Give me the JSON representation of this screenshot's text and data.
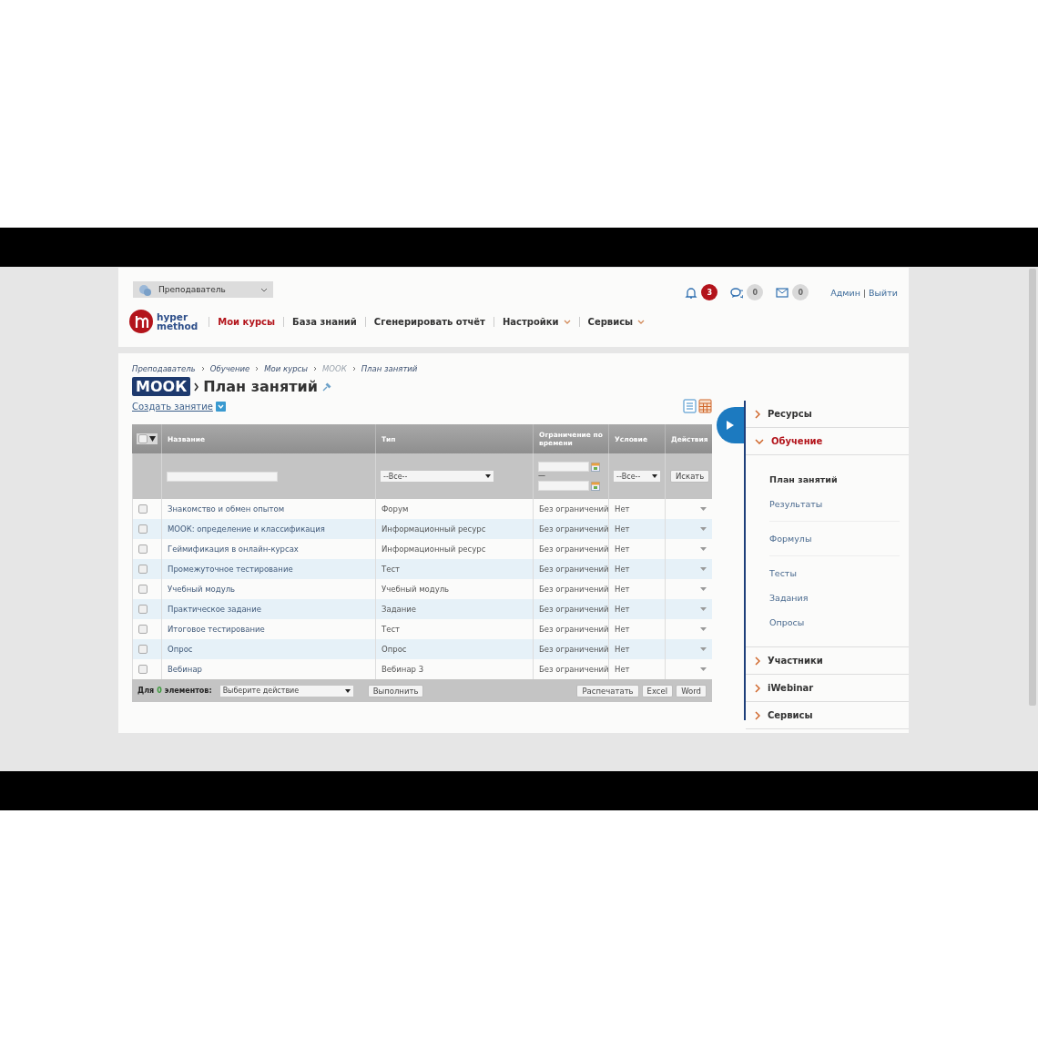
{
  "header": {
    "role_select": "Преподаватель",
    "logo": {
      "line1": "hyper",
      "line2": "method"
    },
    "nav": [
      {
        "label": "Мои курсы",
        "selected": true,
        "dropdown": false
      },
      {
        "label": "База знаний",
        "selected": false,
        "dropdown": false
      },
      {
        "label": "Сгенерировать отчёт",
        "selected": false,
        "dropdown": false
      },
      {
        "label": "Настройки",
        "selected": false,
        "dropdown": true
      },
      {
        "label": "Сервисы",
        "selected": false,
        "dropdown": true
      }
    ],
    "notifications": [
      {
        "kind": "bell",
        "count": "3",
        "highlighted": true
      },
      {
        "kind": "chat",
        "count": "0",
        "highlighted": false
      },
      {
        "kind": "mail",
        "count": "0",
        "highlighted": false
      }
    ],
    "user": "Админ",
    "user_separator": "|",
    "logout": "Выйти"
  },
  "breadcrumbs": [
    {
      "label": "Преподаватель",
      "disabled": false
    },
    {
      "label": "Обучение",
      "disabled": false
    },
    {
      "label": "Мои курсы",
      "disabled": false
    },
    {
      "label": "МООК",
      "disabled": true
    },
    {
      "label": "План занятий",
      "disabled": false
    }
  ],
  "title": {
    "course": "МООК",
    "page": "План занятий"
  },
  "create_link": "Создать занятие",
  "table": {
    "select_all": {
      "checked": false
    },
    "columns": [
      "Название",
      "Тип",
      "Ограничение по времени",
      "Условие",
      "Действия"
    ],
    "filters": {
      "type": "--Все--",
      "range_separator": "—",
      "condition": "--Все--",
      "search_button": "Искать"
    },
    "rows": [
      {
        "name": "Знакомство и обмен опытом",
        "type": "Форум",
        "time_limit": "Без ограничений",
        "condition": "Нет",
        "checked": false
      },
      {
        "name": "МООК: определение и классификация",
        "type": "Информационный ресурс",
        "time_limit": "Без ограничений",
        "condition": "Нет",
        "checked": false
      },
      {
        "name": "Геймификация в онлайн-курсах",
        "type": "Информационный ресурс",
        "time_limit": "Без ограничений",
        "condition": "Нет",
        "checked": false
      },
      {
        "name": "Промежуточное тестирование",
        "type": "Тест",
        "time_limit": "Без ограничений",
        "condition": "Нет",
        "checked": false
      },
      {
        "name": "Учебный модуль",
        "type": "Учебный модуль",
        "time_limit": "Без ограничений",
        "condition": "Нет",
        "checked": false
      },
      {
        "name": "Практическое задание",
        "type": "Задание",
        "time_limit": "Без ограничений",
        "condition": "Нет",
        "checked": false
      },
      {
        "name": "Итоговое тестирование",
        "type": "Тест",
        "time_limit": "Без ограничений",
        "condition": "Нет",
        "checked": false
      },
      {
        "name": "Опрос",
        "type": "Опрос",
        "time_limit": "Без ограничений",
        "condition": "Нет",
        "checked": false
      },
      {
        "name": "Вебинар",
        "type": "Вебинар 3",
        "time_limit": "Без ограничений",
        "condition": "Нет",
        "checked": false
      }
    ],
    "footer": {
      "prefix": "Для",
      "count": "0",
      "suffix": "элементов:",
      "action": "Выберите действие",
      "run": "Выполнить",
      "buttons": [
        "Распечатать",
        "Excel",
        "Word"
      ]
    }
  },
  "sidebar": {
    "items": [
      {
        "label": "Ресурсы",
        "expanded": false
      },
      {
        "label": "Обучение",
        "expanded": true,
        "groups": [
          {
            "items": [
              {
                "label": "План занятий",
                "selected": true
              },
              {
                "label": "Результаты",
                "selected": false
              }
            ]
          },
          {
            "items": [
              {
                "label": "Формулы",
                "selected": false
              }
            ]
          },
          {
            "items": [
              {
                "label": "Тесты",
                "selected": false
              },
              {
                "label": "Задания",
                "selected": false
              },
              {
                "label": "Опросы",
                "selected": false
              }
            ]
          }
        ]
      },
      {
        "label": "Участники",
        "expanded": false
      },
      {
        "label": "iWebinar",
        "expanded": false
      },
      {
        "label": "Сервисы",
        "expanded": false
      }
    ]
  }
}
